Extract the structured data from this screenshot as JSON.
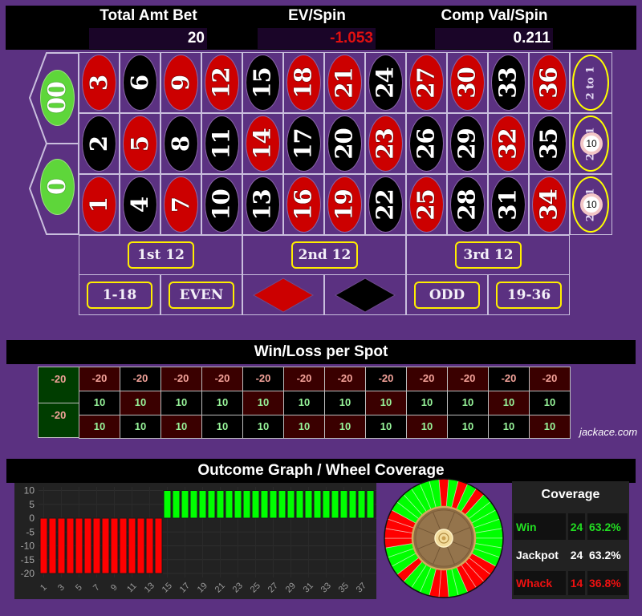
{
  "header": {
    "total_bet": {
      "label": "Total Amt Bet",
      "value": "20"
    },
    "ev_spin": {
      "label": "EV/Spin",
      "value": "-1.053"
    },
    "comp_val": {
      "label": "Comp Val/Spin",
      "value": "0.211"
    }
  },
  "colors": {
    "red": "#cc0000",
    "black": "#000000",
    "green": "#5ed63a",
    "win": "#00ff00",
    "loss": "#ff0000",
    "accent": "#ffff00",
    "felt": "#5b3181"
  },
  "board": {
    "zeros": [
      {
        "label": "00"
      },
      {
        "label": "0"
      }
    ],
    "rows": [
      [
        {
          "n": "3",
          "c": "red"
        },
        {
          "n": "6",
          "c": "black"
        },
        {
          "n": "9",
          "c": "red"
        },
        {
          "n": "12",
          "c": "red"
        },
        {
          "n": "15",
          "c": "black"
        },
        {
          "n": "18",
          "c": "red"
        },
        {
          "n": "21",
          "c": "red"
        },
        {
          "n": "24",
          "c": "black"
        },
        {
          "n": "27",
          "c": "red"
        },
        {
          "n": "30",
          "c": "red"
        },
        {
          "n": "33",
          "c": "black"
        },
        {
          "n": "36",
          "c": "red"
        }
      ],
      [
        {
          "n": "2",
          "c": "black"
        },
        {
          "n": "5",
          "c": "red"
        },
        {
          "n": "8",
          "c": "black"
        },
        {
          "n": "11",
          "c": "black"
        },
        {
          "n": "14",
          "c": "red"
        },
        {
          "n": "17",
          "c": "black"
        },
        {
          "n": "20",
          "c": "black"
        },
        {
          "n": "23",
          "c": "red"
        },
        {
          "n": "26",
          "c": "black"
        },
        {
          "n": "29",
          "c": "black"
        },
        {
          "n": "32",
          "c": "red"
        },
        {
          "n": "35",
          "c": "black"
        }
      ],
      [
        {
          "n": "1",
          "c": "red"
        },
        {
          "n": "4",
          "c": "black"
        },
        {
          "n": "7",
          "c": "red"
        },
        {
          "n": "10",
          "c": "black"
        },
        {
          "n": "13",
          "c": "black"
        },
        {
          "n": "16",
          "c": "red"
        },
        {
          "n": "19",
          "c": "red"
        },
        {
          "n": "22",
          "c": "black"
        },
        {
          "n": "25",
          "c": "red"
        },
        {
          "n": "28",
          "c": "black"
        },
        {
          "n": "31",
          "c": "black"
        },
        {
          "n": "34",
          "c": "red"
        }
      ]
    ],
    "columns": [
      {
        "label": "2 to 1",
        "chip": null
      },
      {
        "label": "2 to 1",
        "chip": "10"
      },
      {
        "label": "2 to 1",
        "chip": "10"
      }
    ],
    "dozens": [
      "1st 12",
      "2nd 12",
      "3rd 12"
    ],
    "outside": [
      {
        "label": "1-18"
      },
      {
        "label": "EVEN"
      },
      {
        "shape": "red-diamond"
      },
      {
        "shape": "black-diamond"
      },
      {
        "label": "ODD"
      },
      {
        "label": "19-36"
      }
    ]
  },
  "winloss": {
    "title": "Win/Loss per Spot",
    "zeros": [
      "-20",
      "-20"
    ],
    "rows": [
      [
        "-20",
        "-20",
        "-20",
        "-20",
        "-20",
        "-20",
        "-20",
        "-20",
        "-20",
        "-20",
        "-20",
        "-20"
      ],
      [
        "10",
        "10",
        "10",
        "10",
        "10",
        "10",
        "10",
        "10",
        "10",
        "10",
        "10",
        "10"
      ],
      [
        "10",
        "10",
        "10",
        "10",
        "10",
        "10",
        "10",
        "10",
        "10",
        "10",
        "10",
        "10"
      ]
    ],
    "watermark": "jackace.com"
  },
  "outcome": {
    "title": "Outcome Graph / Wheel Coverage"
  },
  "chart_data": {
    "type": "bar",
    "title": "Outcome Graph",
    "xlabel": "",
    "ylabel": "",
    "categories": [
      "1",
      "2",
      "3",
      "4",
      "5",
      "6",
      "7",
      "8",
      "9",
      "10",
      "11",
      "12",
      "13",
      "14",
      "15",
      "16",
      "17",
      "18",
      "19",
      "20",
      "21",
      "22",
      "23",
      "24",
      "25",
      "26",
      "27",
      "28",
      "29",
      "30",
      "31",
      "32",
      "33",
      "34",
      "35",
      "36",
      "37",
      "38"
    ],
    "values": [
      -20,
      -20,
      -20,
      -20,
      -20,
      -20,
      -20,
      -20,
      -20,
      -20,
      -20,
      -20,
      -20,
      -20,
      10,
      10,
      10,
      10,
      10,
      10,
      10,
      10,
      10,
      10,
      10,
      10,
      10,
      10,
      10,
      10,
      10,
      10,
      10,
      10,
      10,
      10,
      10,
      10
    ],
    "xtick_labels": [
      "1",
      "3",
      "5",
      "7",
      "9",
      "11",
      "13",
      "15",
      "17",
      "19",
      "21",
      "23",
      "25",
      "27",
      "29",
      "31",
      "33",
      "35",
      "37"
    ],
    "yticks": [
      10,
      5,
      0,
      -5,
      -10,
      -15,
      -20
    ],
    "ylim": [
      -20,
      10
    ],
    "grid": true,
    "legend": "none",
    "colors": {
      "negative": "#ff0000",
      "positive": "#00ff00"
    }
  },
  "wheel": {
    "segments": [
      {
        "n": "0",
        "r": "L"
      },
      {
        "n": "28",
        "r": "W"
      },
      {
        "n": "9",
        "r": "L"
      },
      {
        "n": "26",
        "r": "W"
      },
      {
        "n": "30",
        "r": "L"
      },
      {
        "n": "11",
        "r": "W"
      },
      {
        "n": "7",
        "r": "W"
      },
      {
        "n": "20",
        "r": "W"
      },
      {
        "n": "32",
        "r": "W"
      },
      {
        "n": "17",
        "r": "W"
      },
      {
        "n": "5",
        "r": "W"
      },
      {
        "n": "22",
        "r": "W"
      },
      {
        "n": "34",
        "r": "W"
      },
      {
        "n": "15",
        "r": "L"
      },
      {
        "n": "3",
        "r": "L"
      },
      {
        "n": "24",
        "r": "L"
      },
      {
        "n": "36",
        "r": "L"
      },
      {
        "n": "13",
        "r": "W"
      },
      {
        "n": "1",
        "r": "W"
      },
      {
        "n": "00",
        "r": "L"
      },
      {
        "n": "27",
        "r": "L"
      },
      {
        "n": "10",
        "r": "W"
      },
      {
        "n": "25",
        "r": "W"
      },
      {
        "n": "29",
        "r": "W"
      },
      {
        "n": "12",
        "r": "L"
      },
      {
        "n": "8",
        "r": "W"
      },
      {
        "n": "19",
        "r": "W"
      },
      {
        "n": "31",
        "r": "W"
      },
      {
        "n": "18",
        "r": "L"
      },
      {
        "n": "6",
        "r": "L"
      },
      {
        "n": "21",
        "r": "L"
      },
      {
        "n": "33",
        "r": "L"
      },
      {
        "n": "16",
        "r": "W"
      },
      {
        "n": "4",
        "r": "W"
      },
      {
        "n": "23",
        "r": "W"
      },
      {
        "n": "35",
        "r": "W"
      },
      {
        "n": "14",
        "r": "W"
      },
      {
        "n": "2",
        "r": "W"
      }
    ]
  },
  "coverage": {
    "title": "Coverage",
    "rows": [
      {
        "label": "Win",
        "count": "24",
        "pct": "63.2%",
        "color": "#22dd22"
      },
      {
        "label": "Jackpot",
        "count": "24",
        "pct": "63.2%",
        "color": "#ffffff"
      },
      {
        "label": "Whack",
        "count": "14",
        "pct": "36.8%",
        "color": "#ee1111"
      }
    ]
  }
}
